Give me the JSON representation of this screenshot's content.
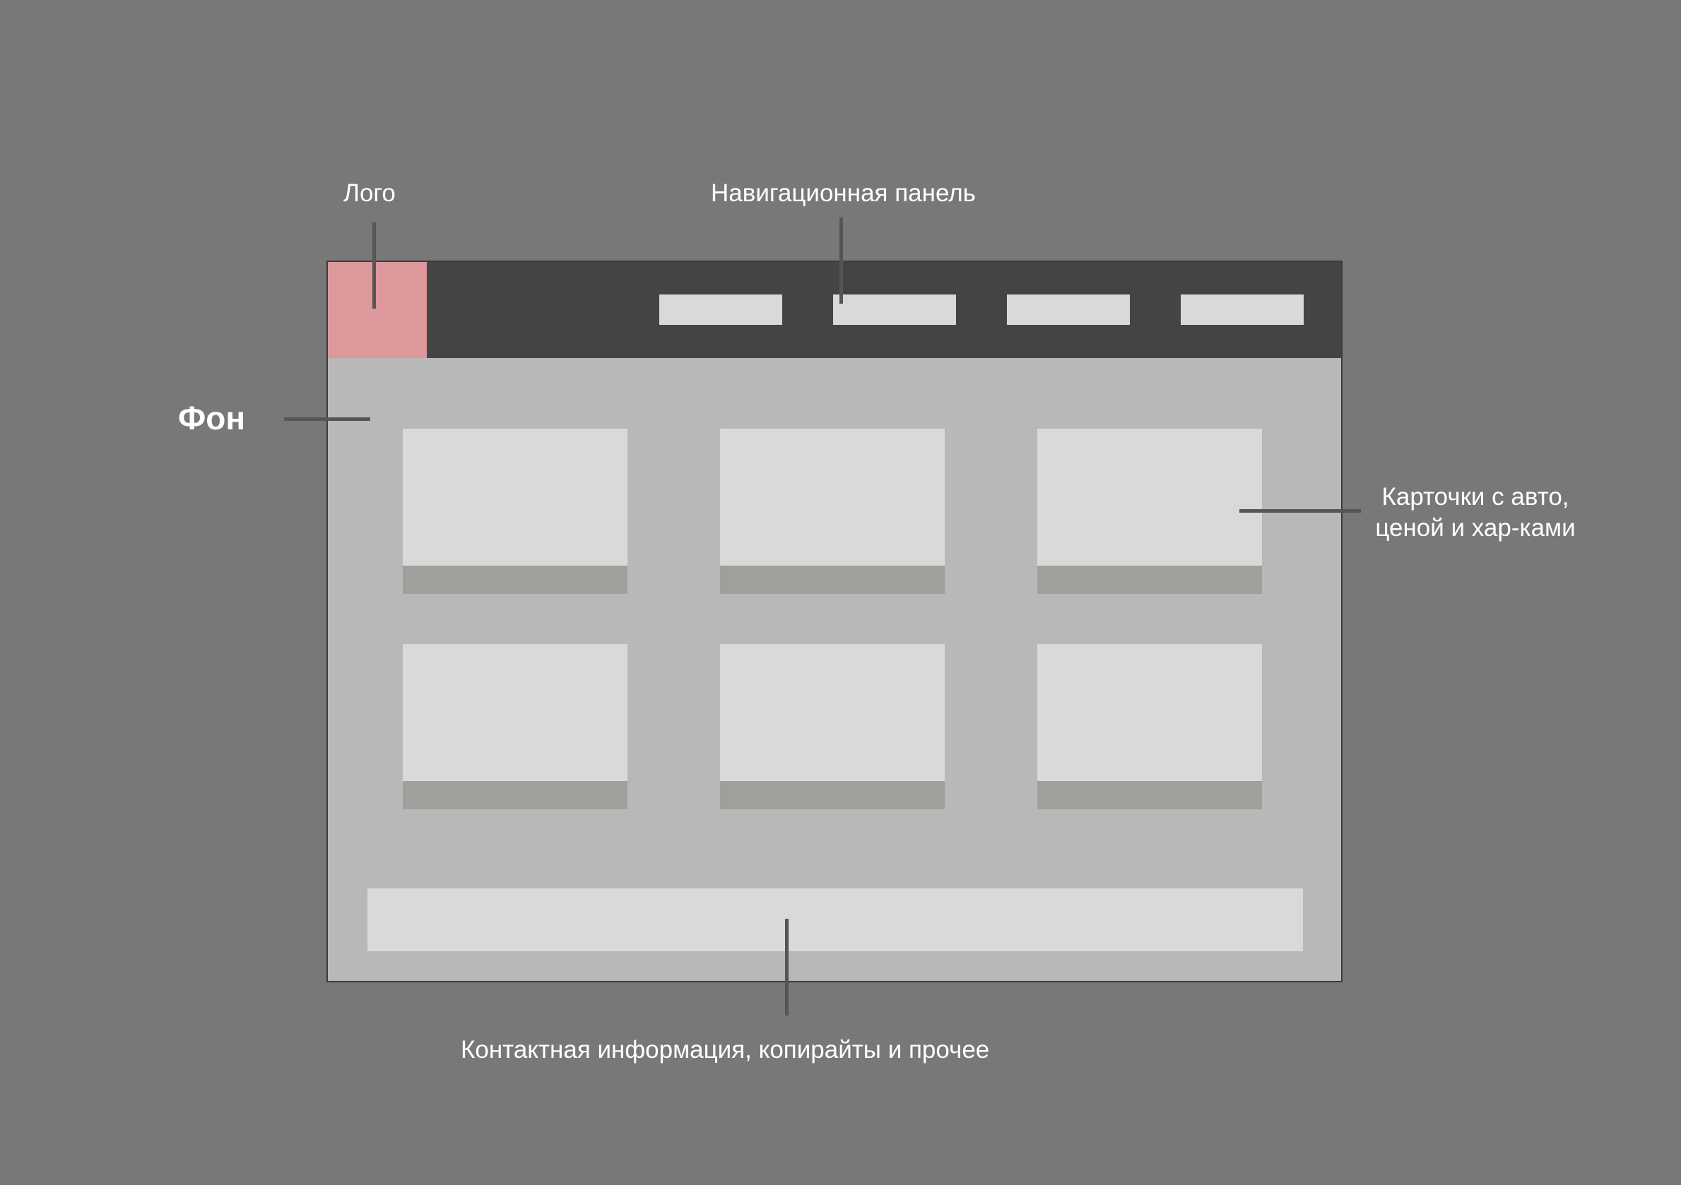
{
  "labels": {
    "logo": "Лого",
    "navigation": "Навигационная панель",
    "background": "Фон",
    "cards_line1": "Карточки с авто,",
    "cards_line2": "ценой и хар-ками",
    "footer": "Контактная информация, копирайты и прочее"
  },
  "colors": {
    "page_background": "#787878",
    "content_background": "#b8b8b8",
    "navbar": "#444444",
    "logo": "#dc989a",
    "placeholder": "#d9d9d9",
    "card_footer": "#a09f9c",
    "leader_line": "#555555"
  }
}
